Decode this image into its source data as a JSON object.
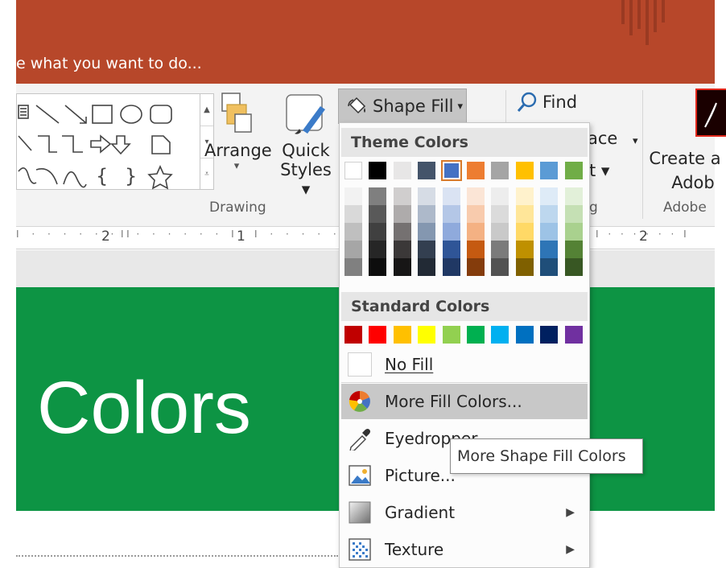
{
  "title_bar": {
    "tell_me": "e what you want to do..."
  },
  "ribbon": {
    "gallery_scroll": [
      "▲",
      "▾",
      "⩡"
    ],
    "arrange_label": "Arrange",
    "arrange_caret": "▾",
    "quick_styles_line1": "Quick",
    "quick_styles_line2": "Styles ▾",
    "drawing_group": "Drawing",
    "shape_fill_label": "Shape Fill",
    "shape_fill_caret": "▾",
    "find_label": "Find",
    "replace_partial": "ace",
    "replace_caret": "▾",
    "select_partial": "t ▾",
    "editing_partial": "g",
    "create_line1": "Create a",
    "create_line2": "Adob",
    "adobe_group": "Adobe"
  },
  "ruler": {
    "labels": [
      "2",
      "1",
      "2"
    ],
    "marks": "I · · · · · · I"
  },
  "slide": {
    "title": "Colors"
  },
  "menu": {
    "theme_header": "Theme Colors",
    "standard_header": "Standard Colors",
    "theme_colors": [
      "#ffffff",
      "#000000",
      "#e7e6e6",
      "#44546a",
      "#4472c4",
      "#ed7d31",
      "#a5a5a5",
      "#ffc000",
      "#5b9bd5",
      "#70ad47"
    ],
    "selected_theme_index": 4,
    "tints": [
      [
        "#f2f2f2",
        "#d9d9d9",
        "#bfbfbf",
        "#a6a6a6",
        "#808080"
      ],
      [
        "#7f7f7f",
        "#595959",
        "#404040",
        "#262626",
        "#0d0d0d"
      ],
      [
        "#d0cece",
        "#aeabab",
        "#757171",
        "#3b3838",
        "#171616"
      ],
      [
        "#d6dce5",
        "#adb9ca",
        "#8497b0",
        "#333f50",
        "#222a35"
      ],
      [
        "#dae3f3",
        "#b4c7e7",
        "#8faadc",
        "#2f5597",
        "#203864"
      ],
      [
        "#fbe5d6",
        "#f8cbad",
        "#f4b183",
        "#c55a11",
        "#843c0c"
      ],
      [
        "#ededed",
        "#dbdbdb",
        "#c9c9c9",
        "#7b7b7b",
        "#525252"
      ],
      [
        "#fff2cc",
        "#ffe699",
        "#ffd966",
        "#bf9000",
        "#7f6000"
      ],
      [
        "#deebf7",
        "#bdd7ee",
        "#9dc3e6",
        "#2e75b6",
        "#1f4e79"
      ],
      [
        "#e2f0d9",
        "#c5e0b4",
        "#a9d18e",
        "#548235",
        "#385723"
      ]
    ],
    "standard_colors": [
      "#c00000",
      "#ff0000",
      "#ffc000",
      "#ffff00",
      "#92d050",
      "#00b050",
      "#00b0f0",
      "#0070c0",
      "#002060",
      "#7030a0"
    ],
    "items": {
      "no_fill": "No Fill",
      "more_fill_colors": "More Fill Colors...",
      "eyedropper": "Eyedropper",
      "picture": "Picture...",
      "gradient": "Gradient",
      "texture": "Texture",
      "submenu_arrow": "▶"
    }
  },
  "tooltip": {
    "text": "More Shape Fill Colors"
  },
  "colors": {
    "title_bar": "#b7472a",
    "slide_bg": "#0d9444",
    "hover": "#c8c8c8"
  }
}
